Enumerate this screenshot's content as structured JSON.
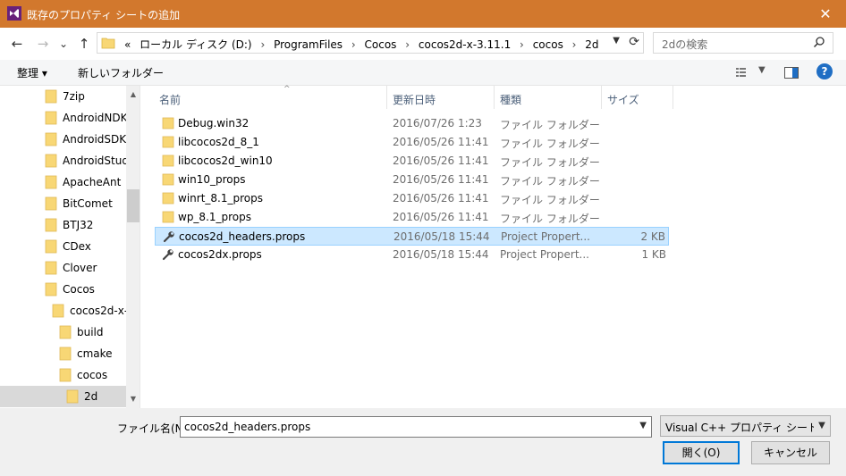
{
  "window": {
    "title": "既存のプロパティ シートの追加",
    "close_glyph": "✕"
  },
  "nav": {
    "back_glyph": "←",
    "forward_glyph": "→",
    "recent_glyph": "⌄",
    "up_glyph": "↑"
  },
  "address": {
    "overflow": "«",
    "crumbs": [
      "ローカル ディスク (D:)",
      "ProgramFiles",
      "Cocos",
      "cocos2d-x-3.11.1",
      "cocos",
      "2d"
    ],
    "separator": "›"
  },
  "search": {
    "placeholder": "2dの検索"
  },
  "toolbar": {
    "organize": "整理 ▾",
    "new_folder": "新しいフォルダー"
  },
  "help": "?",
  "tree": {
    "items": [
      {
        "label": "7zip"
      },
      {
        "label": "AndroidNDK"
      },
      {
        "label": "AndroidSDK"
      },
      {
        "label": "AndroidStud"
      },
      {
        "label": "ApacheAnt"
      },
      {
        "label": "BitComet"
      },
      {
        "label": "BTJ32"
      },
      {
        "label": "CDex"
      },
      {
        "label": "Clover"
      },
      {
        "label": "Cocos"
      },
      {
        "label": "cocos2d-x-"
      },
      {
        "label": "build"
      },
      {
        "label": "cmake"
      },
      {
        "label": "cocos"
      },
      {
        "label": "2d"
      }
    ]
  },
  "columns": [
    {
      "label": "名前"
    },
    {
      "label": "更新日時"
    },
    {
      "label": "種類"
    },
    {
      "label": "サイズ"
    }
  ],
  "files": [
    {
      "name": "Debug.win32",
      "date": "2016/07/26 1:23",
      "type": "ファイル フォルダー",
      "size": "",
      "kind": "folder"
    },
    {
      "name": "libcocos2d_8_1",
      "date": "2016/05/26 11:41",
      "type": "ファイル フォルダー",
      "size": "",
      "kind": "folder"
    },
    {
      "name": "libcocos2d_win10",
      "date": "2016/05/26 11:41",
      "type": "ファイル フォルダー",
      "size": "",
      "kind": "folder"
    },
    {
      "name": "win10_props",
      "date": "2016/05/26 11:41",
      "type": "ファイル フォルダー",
      "size": "",
      "kind": "folder"
    },
    {
      "name": "winrt_8.1_props",
      "date": "2016/05/26 11:41",
      "type": "ファイル フォルダー",
      "size": "",
      "kind": "folder"
    },
    {
      "name": "wp_8.1_props",
      "date": "2016/05/26 11:41",
      "type": "ファイル フォルダー",
      "size": "",
      "kind": "folder"
    },
    {
      "name": "cocos2d_headers.props",
      "date": "2016/05/18 15:44",
      "type": "Project Propert...",
      "size": "2 KB",
      "kind": "props"
    },
    {
      "name": "cocos2dx.props",
      "date": "2016/05/18 15:44",
      "type": "Project Propert...",
      "size": "1 KB",
      "kind": "props"
    }
  ],
  "bottom": {
    "filename_label": "ファイル名(N):",
    "filename_value": "cocos2d_headers.props",
    "filter_value": "Visual C++ プロパティ シート (*.prc",
    "open_label": "開く(O)",
    "cancel_label": "キャンセル"
  },
  "colors": {
    "titlebar": "#d2782d",
    "selection": "#cce8ff",
    "folder": "#f8d775",
    "accent": "#0078d7"
  }
}
